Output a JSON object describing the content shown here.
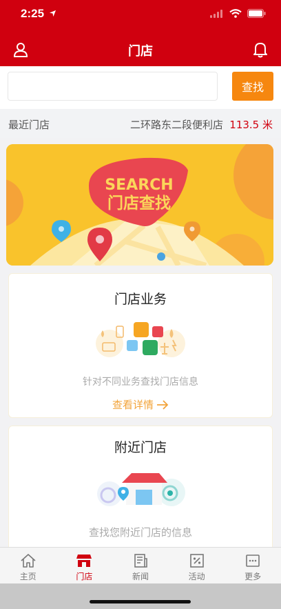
{
  "status": {
    "time": "2:25"
  },
  "nav": {
    "title": "门店",
    "left_icon": "user-icon",
    "right_icon": "bell-icon"
  },
  "search": {
    "value": "",
    "placeholder": "",
    "button_label": "查找"
  },
  "nearest": {
    "label": "最近门店",
    "store_name": "二环路东二段便利店",
    "distance": "113.5 米"
  },
  "banner": {
    "line1": "SEARCH",
    "line2": "门店查找"
  },
  "cards": [
    {
      "title": "门店业务",
      "description": "针对不同业务查找门店信息",
      "link_label": "查看详情"
    },
    {
      "title": "附近门店",
      "description": "查找您附近门店的信息"
    }
  ],
  "tabs": [
    {
      "label": "主页",
      "icon": "home-icon",
      "active": false
    },
    {
      "label": "门店",
      "icon": "store-icon",
      "active": true
    },
    {
      "label": "新闻",
      "icon": "news-icon",
      "active": false
    },
    {
      "label": "活动",
      "icon": "discount-icon",
      "active": false
    },
    {
      "label": "更多",
      "icon": "more-icon",
      "active": false
    }
  ],
  "colors": {
    "brand_red": "#d0000f",
    "accent_orange": "#f6870f",
    "link_orange": "#f2a43b"
  }
}
